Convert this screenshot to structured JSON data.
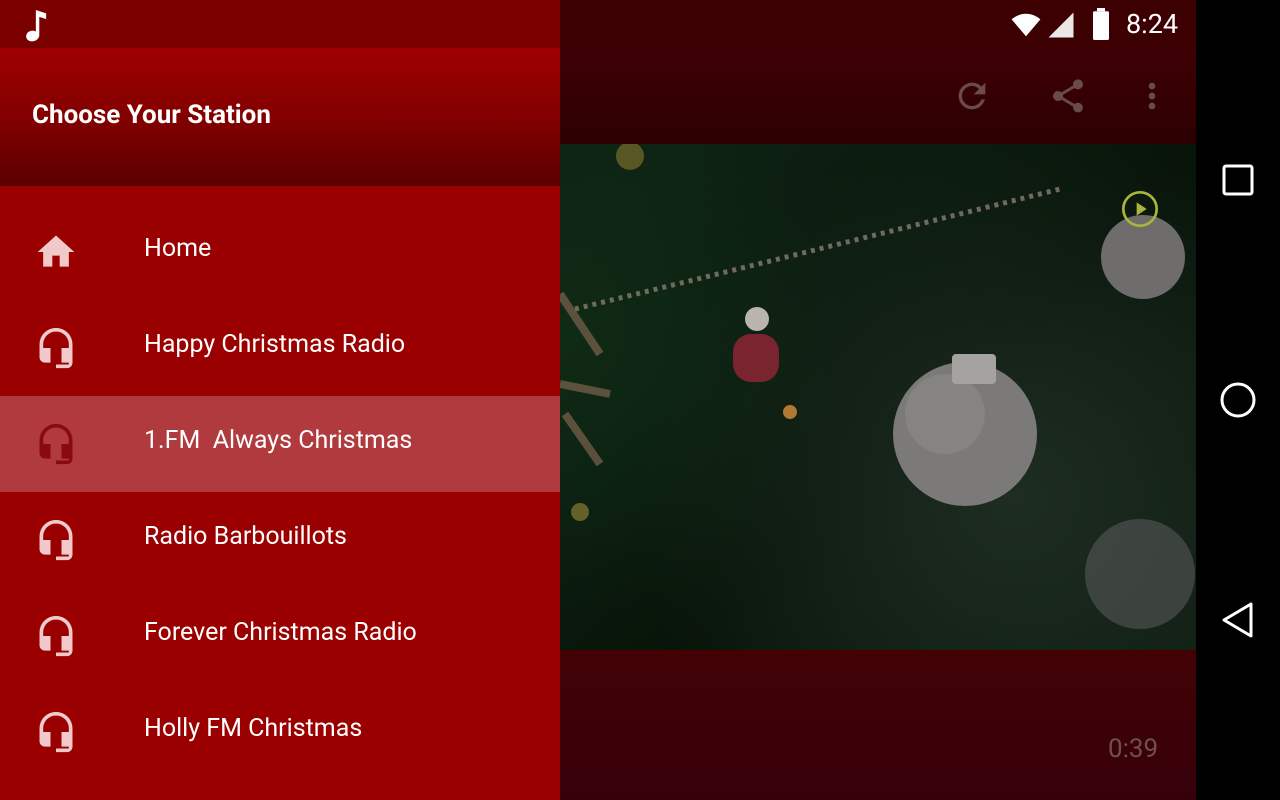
{
  "status": {
    "time": "8:24"
  },
  "drawer": {
    "title": "Choose Your Station",
    "items": [
      {
        "label": "Home",
        "icon": "home-icon"
      },
      {
        "label": "Happy Christmas Radio",
        "icon": "headphones-icon"
      },
      {
        "label": "1.FM  Always Christmas",
        "icon": "headphones-icon",
        "selected": true
      },
      {
        "label": "Radio Barbouillots",
        "icon": "headphones-icon"
      },
      {
        "label": "Forever Christmas Radio",
        "icon": "headphones-icon"
      },
      {
        "label": "Holly FM Christmas",
        "icon": "headphones-icon"
      }
    ]
  },
  "player": {
    "elapsed": "0:39"
  },
  "colors": {
    "drawer": "#9a0000",
    "drawer_selected": "#b03a3d",
    "accent": "#a8b63a"
  }
}
